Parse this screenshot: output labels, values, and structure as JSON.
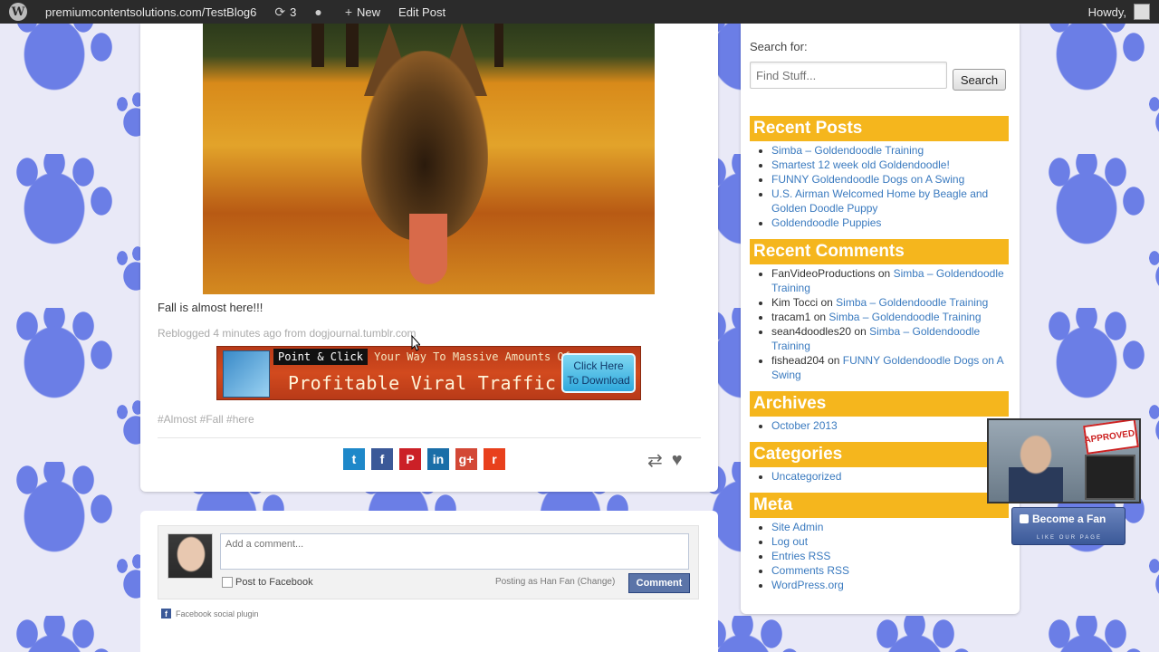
{
  "adminbar": {
    "site_url": "premiumcontentsolutions.com/TestBlog6",
    "updates_count": "3",
    "new_label": "New",
    "edit_post_label": "Edit Post",
    "howdy": "Howdy,"
  },
  "post": {
    "text": "Fall is almost here!!!",
    "reblog_prefix": "Reblogged 4 minutes ago from",
    "reblog_source": "dogjournal.tumblr.com",
    "banner": {
      "point_click": "Point & Click",
      "top_rest": "Your Way To Massive Amounts Of",
      "main": "Profitable Viral Traffic",
      "button_line1": "Click Here",
      "button_line2": "To Download"
    },
    "tags": "#Almost #Fall #here",
    "share_buttons": [
      {
        "name": "twitter",
        "glyph": "t",
        "color": "#1e88c9"
      },
      {
        "name": "facebook",
        "glyph": "f",
        "color": "#3b5998"
      },
      {
        "name": "pinterest",
        "glyph": "P",
        "color": "#cb2027"
      },
      {
        "name": "linkedin",
        "glyph": "in",
        "color": "#1a6ea8"
      },
      {
        "name": "googleplus",
        "glyph": "g+",
        "color": "#d34836"
      },
      {
        "name": "reddit",
        "glyph": "r",
        "color": "#e8401c"
      }
    ]
  },
  "comments": {
    "placeholder": "Add a comment...",
    "post_to_facebook": "Post to Facebook",
    "posting_as": "Posting as Han Fan (Change)",
    "comment_button": "Comment",
    "plugin_label": "Facebook social plugin"
  },
  "sidebar": {
    "search_label": "Search for:",
    "search_placeholder": "Find Stuff...",
    "search_button": "Search",
    "recent_posts_title": "Recent Posts",
    "recent_posts": [
      "Simba – Goldendoodle Training",
      "Smartest 12 week old Goldendoodle!",
      "FUNNY Goldendoodle Dogs on A Swing",
      "U.S. Airman Welcomed Home by Beagle and Golden Doodle Puppy",
      "Goldendoodle Puppies"
    ],
    "recent_comments_title": "Recent Comments",
    "recent_comments": [
      {
        "author": "FanVideoProductions",
        "on": "on",
        "post": "Simba – Goldendoodle Training"
      },
      {
        "author": "Kim Tocci",
        "on": "on",
        "post": "Simba – Goldendoodle Training"
      },
      {
        "author": "tracam1",
        "on": "on",
        "post": "Simba – Goldendoodle Training"
      },
      {
        "author": "sean4doodles20",
        "on": "on",
        "post": "Simba – Goldendoodle Training"
      },
      {
        "author": "fishead204",
        "on": "on",
        "post": "FUNNY Goldendoodle Dogs on A Swing"
      }
    ],
    "archives_title": "Archives",
    "archives": [
      "October 2013"
    ],
    "categories_title": "Categories",
    "categories": [
      "Uncategorized"
    ],
    "meta_title": "Meta",
    "meta": [
      "Site Admin",
      "Log out",
      "Entries RSS",
      "Comments RSS",
      "WordPress.org"
    ]
  },
  "overlay": {
    "sign_text": "APPROVED!",
    "fan_button": "Become a Fan",
    "fan_sub": "LIKE OUR PAGE"
  },
  "colors": {
    "widget_title_bg": "#f5b61d",
    "link": "#3a7abf",
    "adminbar_bg": "#2b2b2b",
    "paw_blue": "#6b7ee6"
  }
}
